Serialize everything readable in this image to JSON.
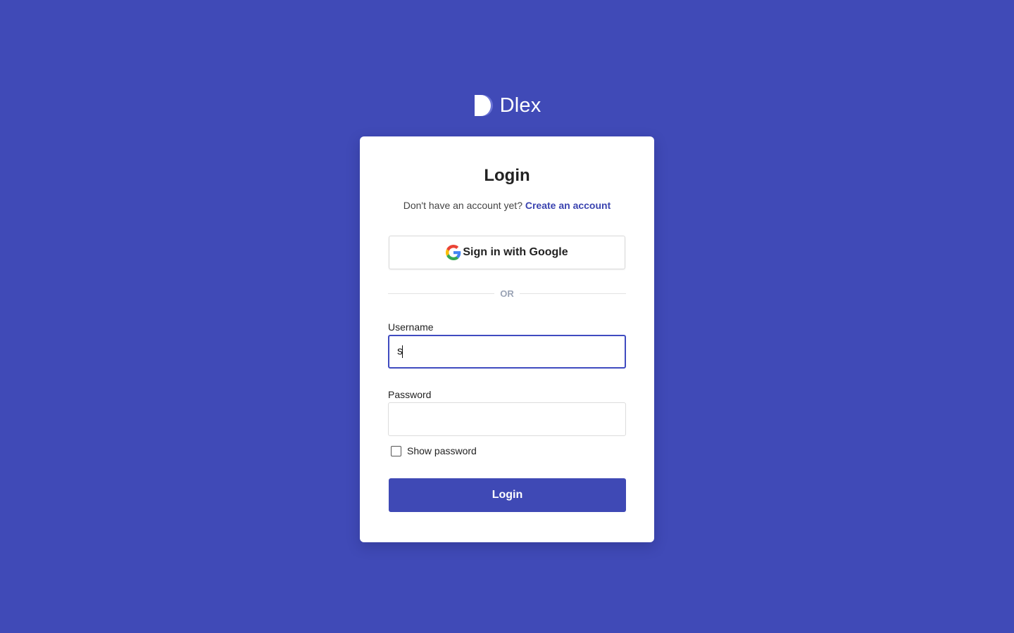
{
  "brand": {
    "name": "Dlex",
    "logo_icon": "dlex-logo-icon"
  },
  "login": {
    "title": "Login",
    "no_account_text": "Don't have an account yet?",
    "create_account_link": "Create an account",
    "google_button_label": "Sign in with Google",
    "divider_text": "OR",
    "username_label": "Username",
    "username_value": "s",
    "password_label": "Password",
    "password_value": "",
    "show_password_label": "Show password",
    "show_password_checked": false,
    "submit_label": "Login"
  },
  "colors": {
    "background": "#404AB7",
    "primary": "#3F49B5",
    "link": "#3B44B0",
    "focus_border": "#3F4BC0"
  }
}
